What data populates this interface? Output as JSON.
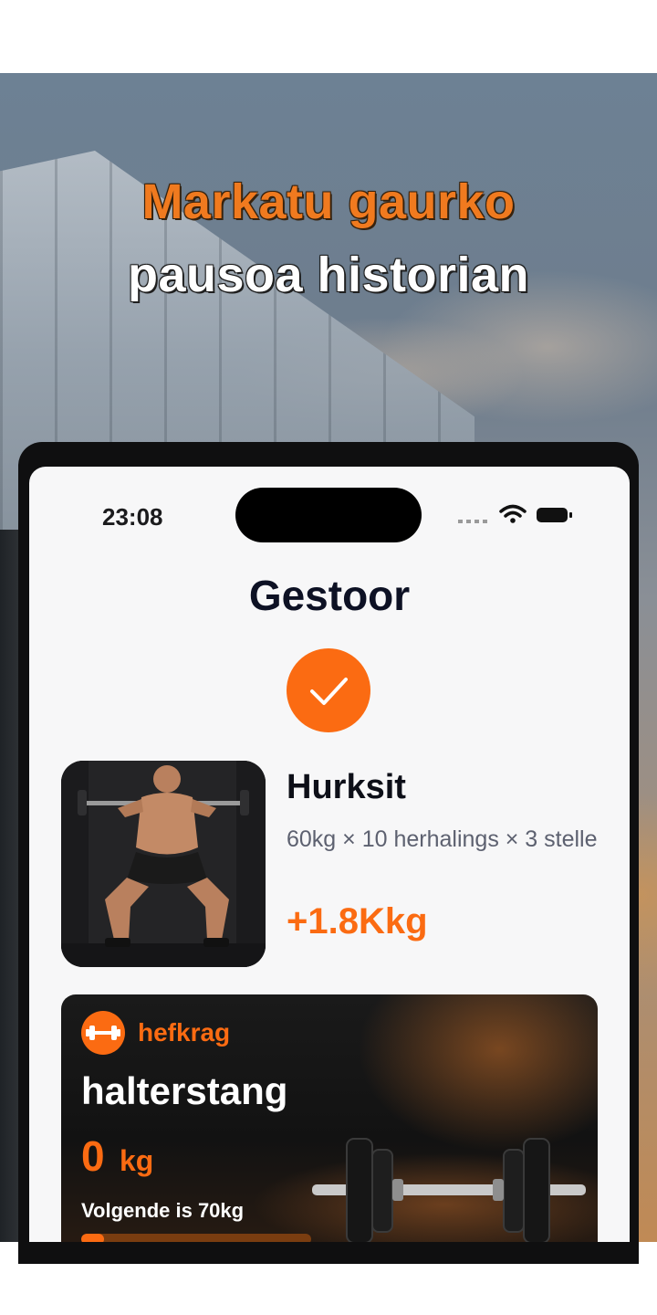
{
  "headline": {
    "line1": "Markatu gaurko",
    "line2": "pausoa historian"
  },
  "status_bar": {
    "time": "23:08"
  },
  "screen": {
    "title": "Gestoor",
    "exercise": {
      "name": "Hurksit",
      "detail": "60kg × 10 herhalings × 3 stelle",
      "gain": "+1.8Kkg"
    },
    "card": {
      "badge": "hefkrag",
      "title": "halterstang",
      "weight_value": "0",
      "weight_unit": "kg",
      "next_label": "Volgende is 70kg",
      "progress": 0.1
    }
  },
  "colors": {
    "accent": "#fb6b12",
    "headline_orange": "#f07a1f",
    "title_dark": "#0d1124"
  },
  "icons": [
    "checkmark-icon",
    "dumbbell-icon",
    "wifi-icon",
    "battery-icon",
    "signal-icon"
  ]
}
